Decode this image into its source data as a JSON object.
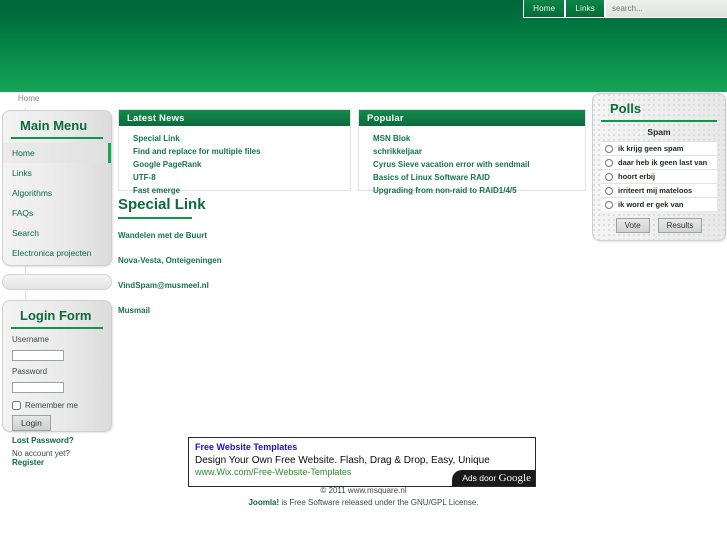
{
  "topnav": {
    "items": [
      {
        "label": "Home"
      },
      {
        "label": "Links"
      }
    ],
    "search_placeholder": "search...",
    "search_value": ""
  },
  "breadcrumb": {
    "text": "Home"
  },
  "sidebar": {
    "main_menu": {
      "title": "Main Menu",
      "items": [
        {
          "label": "Home",
          "active": true
        },
        {
          "label": "Links",
          "active": false
        },
        {
          "label": "Algorithms",
          "active": false
        },
        {
          "label": "FAQs",
          "active": false
        },
        {
          "label": "Search",
          "active": false
        },
        {
          "label": "Electronica projecten",
          "active": false
        }
      ]
    },
    "login_form": {
      "title": "Login Form",
      "username_label": "Username",
      "username_value": "",
      "password_label": "Password",
      "password_value": "",
      "remember_label": "Remember me",
      "login_button": "Login",
      "lost_password": "Lost Password?",
      "no_account_text": "No account yet?",
      "register_link": "Register"
    }
  },
  "latest_news": {
    "title": "Latest News",
    "items": [
      {
        "label": "Special Link"
      },
      {
        "label": "Find and replace for multiple files"
      },
      {
        "label": "Google PageRank"
      },
      {
        "label": "UTF-8"
      },
      {
        "label": "Fast emerge"
      }
    ]
  },
  "popular": {
    "title": "Popular",
    "items": [
      {
        "label": "MSN Blok"
      },
      {
        "label": "schrikkeljaar"
      },
      {
        "label": "Cyrus Sieve vacation error with sendmail"
      },
      {
        "label": "Basics of Linux Software RAID"
      },
      {
        "label": "Upgrading from non-raid to RAID1/4/5"
      }
    ]
  },
  "article": {
    "title": "Special Link",
    "links": [
      {
        "label": "Wandelen met de Buurt"
      },
      {
        "label": "Nova-Vesta, Onteigeningen"
      },
      {
        "label": "VindSpam@musmeel.nl"
      },
      {
        "label": "Musmail"
      }
    ]
  },
  "polls": {
    "title": "Polls",
    "question": "Spam",
    "options": [
      {
        "label": "ik krijg geen spam"
      },
      {
        "label": "daar heb ik geen last van"
      },
      {
        "label": "hoort erbij"
      },
      {
        "label": "irriteert mij mateloos"
      },
      {
        "label": "ik word er gek van"
      }
    ],
    "vote_button": "Vote",
    "results_button": "Results"
  },
  "advert": {
    "title": "Free Website Templates",
    "description": "Design Your Own Free Website. Flash, Drag & Drop, Easy, Unique",
    "url": "www.Wix.com/Free-Website-Templates",
    "badge_text": "Ads door",
    "badge_brand": "Google"
  },
  "footer": {
    "copyright": "© 2011 www.msquare.nl",
    "joomla_name": "Joomla!",
    "joomla_rest": " is Free Software released under the GNU/GPL License."
  },
  "colors": {
    "brand_green": "#0c6b3c",
    "header_green_top": "#00633a",
    "header_green_bottom": "#16a457",
    "link_green": "#16744a",
    "ad_blue": "#1414cc",
    "ad_url_green": "#2e8b2e"
  }
}
